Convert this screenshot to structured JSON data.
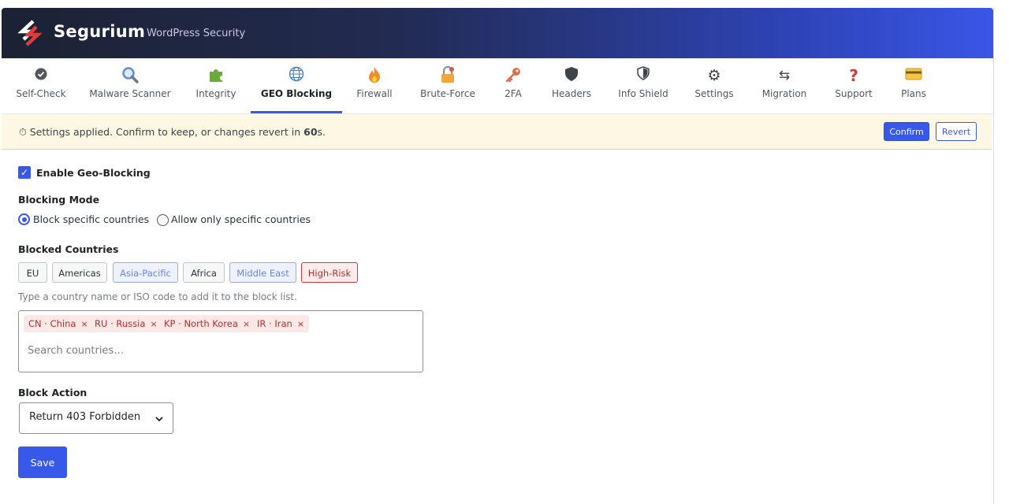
{
  "app": {
    "brand": "Segurium",
    "tagline": "WordPress Security",
    "accent": "#3858e9"
  },
  "tabs": [
    {
      "label": "Self-Check",
      "icon": "check-circle-icon"
    },
    {
      "label": "Malware Scanner",
      "icon": "magnifier-icon"
    },
    {
      "label": "Integrity",
      "icon": "puzzle-icon"
    },
    {
      "label": "GEO Blocking",
      "icon": "globe-icon",
      "active": true
    },
    {
      "label": "Firewall",
      "icon": "fire-icon"
    },
    {
      "label": "Brute-Force",
      "icon": "lock-icon"
    },
    {
      "label": "2FA",
      "icon": "key-icon"
    },
    {
      "label": "Headers",
      "icon": "shield-icon"
    },
    {
      "label": "Info Shield",
      "icon": "info-shield-icon"
    },
    {
      "label": "Settings",
      "icon": "gear-icon"
    },
    {
      "label": "Migration",
      "icon": "arrows-icon"
    },
    {
      "label": "Support",
      "icon": "question-icon"
    },
    {
      "label": "Plans",
      "icon": "card-icon"
    }
  ],
  "notice": {
    "prefix": "Settings applied. Confirm to keep, or changes revert in ",
    "seconds": "60",
    "suffix": "s.",
    "confirm_label": "Confirm",
    "revert_label": "Revert"
  },
  "geo": {
    "enable_label": "Enable Geo-Blocking",
    "enabled": true,
    "mode_title": "Blocking Mode",
    "mode_options": [
      "Block specific countries",
      "Allow only specific countries"
    ],
    "mode_selected": "Block specific countries",
    "countries_title": "Blocked Countries",
    "presets": [
      "EU",
      "Americas",
      "Asia-Pacific",
      "Africa",
      "Middle East",
      "High-Risk"
    ],
    "hint": "Type a country name or ISO code to add it to the block list.",
    "tags": [
      "CN · China",
      "RU · Russia",
      "KP · North Korea",
      "IR · Iran"
    ],
    "tag_remove": "×",
    "search_placeholder": "Search countries…",
    "action_title": "Block Action",
    "action_value": "Return 403 Forbidden",
    "save_label": "Save"
  }
}
